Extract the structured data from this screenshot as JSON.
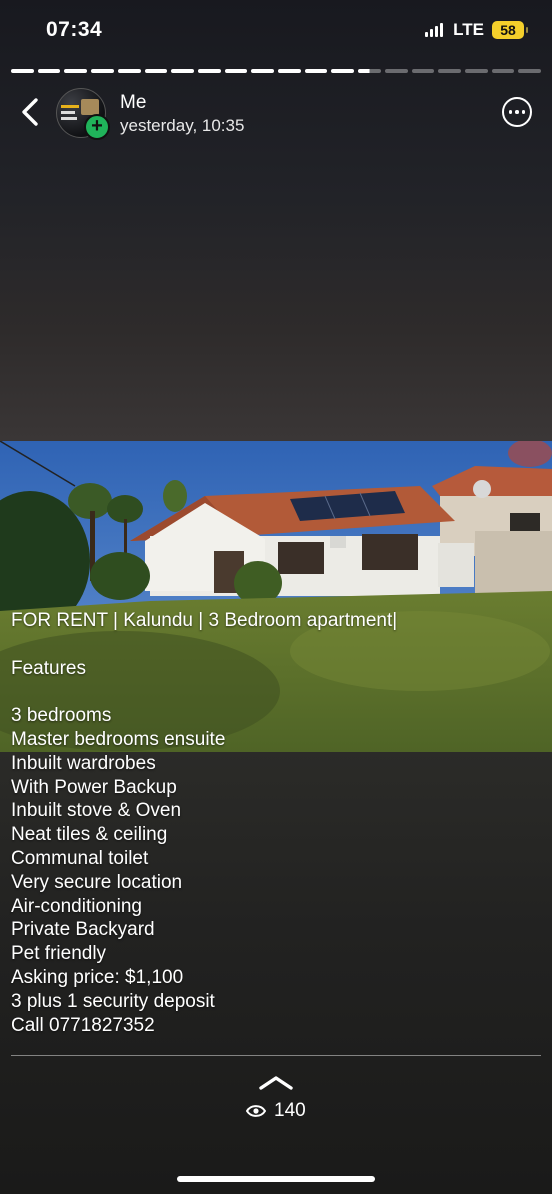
{
  "status_bar": {
    "time": "07:34",
    "network": "LTE",
    "battery": "58"
  },
  "story": {
    "segments_total": 20,
    "current_segment": 14
  },
  "header": {
    "sender": "Me",
    "timestamp": "yesterday, 10:35"
  },
  "icons": {
    "back": "chevron-left-icon",
    "more": "more-options-icon",
    "add": "plus-icon",
    "views": "eye-icon",
    "reply": "chevron-up-icon"
  },
  "caption": {
    "title": "FOR RENT | Kalundu | 3 Bedroom apartment|",
    "features_heading": "Features",
    "lines": [
      "3 bedrooms",
      "Master bedrooms ensuite",
      "Inbuilt wardrobes",
      "With Power Backup",
      "Inbuilt stove & Oven",
      "Neat tiles & ceiling",
      "Communal toilet",
      "Very secure location",
      "Air-conditioning",
      "Private Backyard",
      "Pet friendly",
      "Asking price: $1,100",
      "3 plus 1 security deposit",
      "Call 0771827352"
    ]
  },
  "footer": {
    "view_count": "140"
  },
  "colors": {
    "badge_green": "#20b35a",
    "battery_yellow": "#f4cf2b"
  }
}
